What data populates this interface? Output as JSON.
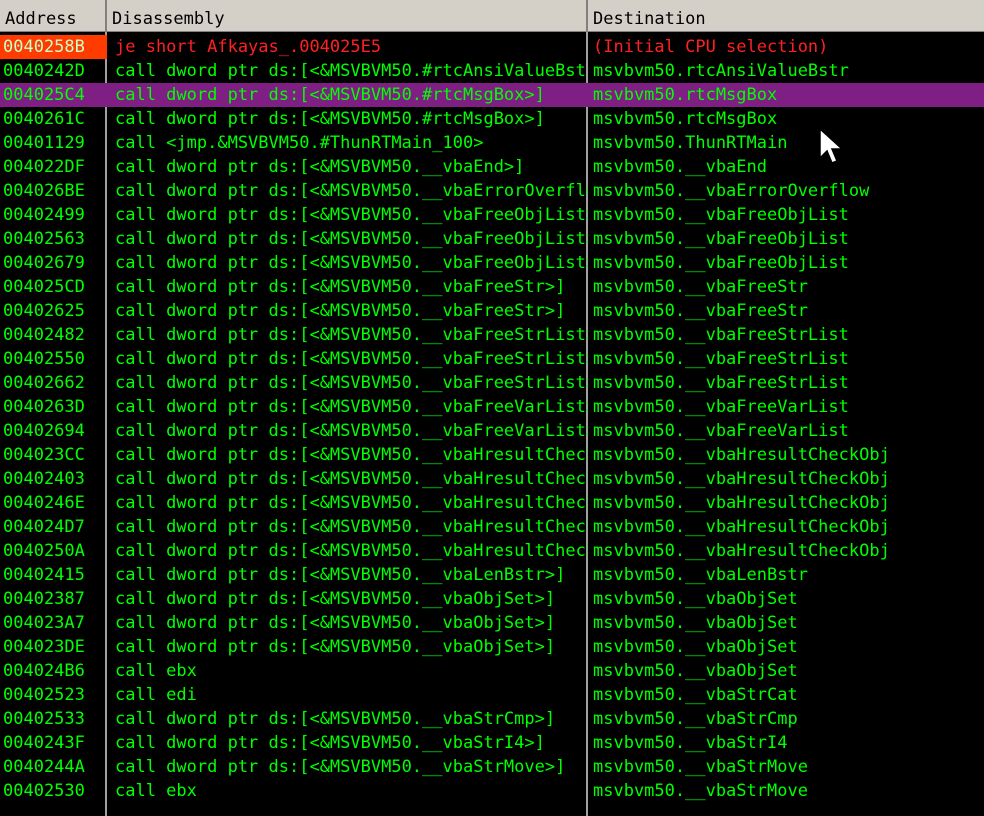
{
  "columns": {
    "address": "Address",
    "disassembly": "Disassembly",
    "destination": "Destination"
  },
  "colors": {
    "background": "#000000",
    "text": "#00ff00",
    "selected_row": "#7f1e83",
    "highlight_address": "#ff3b00",
    "red_text": "#ff2020"
  },
  "rows": [
    {
      "address": "0040258B",
      "disassembly": "je short Afkayas_.004025E5",
      "destination": "(Initial CPU selection)"
    },
    {
      "address": "0040242D",
      "disassembly": "call dword ptr ds:[<&MSVBVM50.#rtcAnsiValueBstr>]",
      "destination": "msvbvm50.rtcAnsiValueBstr"
    },
    {
      "address": "004025C4",
      "disassembly": "call dword ptr ds:[<&MSVBVM50.#rtcMsgBox>]",
      "destination": "msvbvm50.rtcMsgBox"
    },
    {
      "address": "0040261C",
      "disassembly": "call dword ptr ds:[<&MSVBVM50.#rtcMsgBox>]",
      "destination": "msvbvm50.rtcMsgBox"
    },
    {
      "address": "00401129",
      "disassembly": "call <jmp.&MSVBVM50.#ThunRTMain_100>",
      "destination": "msvbvm50.ThunRTMain"
    },
    {
      "address": "004022DF",
      "disassembly": "call dword ptr ds:[<&MSVBVM50.__vbaEnd>]",
      "destination": "msvbvm50.__vbaEnd"
    },
    {
      "address": "004026BE",
      "disassembly": "call dword ptr ds:[<&MSVBVM50.__vbaErrorOverflow>]",
      "destination": "msvbvm50.__vbaErrorOverflow"
    },
    {
      "address": "00402499",
      "disassembly": "call dword ptr ds:[<&MSVBVM50.__vbaFreeObjList>]",
      "destination": "msvbvm50.__vbaFreeObjList"
    },
    {
      "address": "00402563",
      "disassembly": "call dword ptr ds:[<&MSVBVM50.__vbaFreeObjList>]",
      "destination": "msvbvm50.__vbaFreeObjList"
    },
    {
      "address": "00402679",
      "disassembly": "call dword ptr ds:[<&MSVBVM50.__vbaFreeObjList>]",
      "destination": "msvbvm50.__vbaFreeObjList"
    },
    {
      "address": "004025CD",
      "disassembly": "call dword ptr ds:[<&MSVBVM50.__vbaFreeStr>]",
      "destination": "msvbvm50.__vbaFreeStr"
    },
    {
      "address": "00402625",
      "disassembly": "call dword ptr ds:[<&MSVBVM50.__vbaFreeStr>]",
      "destination": "msvbvm50.__vbaFreeStr"
    },
    {
      "address": "00402482",
      "disassembly": "call dword ptr ds:[<&MSVBVM50.__vbaFreeStrList>]",
      "destination": "msvbvm50.__vbaFreeStrList"
    },
    {
      "address": "00402550",
      "disassembly": "call dword ptr ds:[<&MSVBVM50.__vbaFreeStrList>]",
      "destination": "msvbvm50.__vbaFreeStrList"
    },
    {
      "address": "00402662",
      "disassembly": "call dword ptr ds:[<&MSVBVM50.__vbaFreeStrList>]",
      "destination": "msvbvm50.__vbaFreeStrList"
    },
    {
      "address": "0040263D",
      "disassembly": "call dword ptr ds:[<&MSVBVM50.__vbaFreeVarList>]",
      "destination": "msvbvm50.__vbaFreeVarList"
    },
    {
      "address": "00402694",
      "disassembly": "call dword ptr ds:[<&MSVBVM50.__vbaFreeVarList>]",
      "destination": "msvbvm50.__vbaFreeVarList"
    },
    {
      "address": "004023CC",
      "disassembly": "call dword ptr ds:[<&MSVBVM50.__vbaHresultCheckObj>]",
      "destination": "msvbvm50.__vbaHresultCheckObj"
    },
    {
      "address": "00402403",
      "disassembly": "call dword ptr ds:[<&MSVBVM50.__vbaHresultCheckObj>]",
      "destination": "msvbvm50.__vbaHresultCheckObj"
    },
    {
      "address": "0040246E",
      "disassembly": "call dword ptr ds:[<&MSVBVM50.__vbaHresultCheckObj>]",
      "destination": "msvbvm50.__vbaHresultCheckObj"
    },
    {
      "address": "004024D7",
      "disassembly": "call dword ptr ds:[<&MSVBVM50.__vbaHresultCheckObj>]",
      "destination": "msvbvm50.__vbaHresultCheckObj"
    },
    {
      "address": "0040250A",
      "disassembly": "call dword ptr ds:[<&MSVBVM50.__vbaHresultCheckObj>]",
      "destination": "msvbvm50.__vbaHresultCheckObj"
    },
    {
      "address": "00402415",
      "disassembly": "call dword ptr ds:[<&MSVBVM50.__vbaLenBstr>]",
      "destination": "msvbvm50.__vbaLenBstr"
    },
    {
      "address": "00402387",
      "disassembly": "call dword ptr ds:[<&MSVBVM50.__vbaObjSet>]",
      "destination": "msvbvm50.__vbaObjSet"
    },
    {
      "address": "004023A7",
      "disassembly": "call dword ptr ds:[<&MSVBVM50.__vbaObjSet>]",
      "destination": "msvbvm50.__vbaObjSet"
    },
    {
      "address": "004023DE",
      "disassembly": "call dword ptr ds:[<&MSVBVM50.__vbaObjSet>]",
      "destination": "msvbvm50.__vbaObjSet"
    },
    {
      "address": "004024B6",
      "disassembly": "call ebx",
      "destination": "msvbvm50.__vbaObjSet"
    },
    {
      "address": "00402523",
      "disassembly": "call edi",
      "destination": "msvbvm50.__vbaStrCat"
    },
    {
      "address": "00402533",
      "disassembly": "call dword ptr ds:[<&MSVBVM50.__vbaStrCmp>]",
      "destination": "msvbvm50.__vbaStrCmp"
    },
    {
      "address": "0040243F",
      "disassembly": "call dword ptr ds:[<&MSVBVM50.__vbaStrI4>]",
      "destination": "msvbvm50.__vbaStrI4"
    },
    {
      "address": "0040244A",
      "disassembly": "call dword ptr ds:[<&MSVBVM50.__vbaStrMove>]",
      "destination": "msvbvm50.__vbaStrMove"
    },
    {
      "address": "00402530",
      "disassembly": "call ebx",
      "destination": "msvbvm50.__vbaStrMove"
    }
  ]
}
